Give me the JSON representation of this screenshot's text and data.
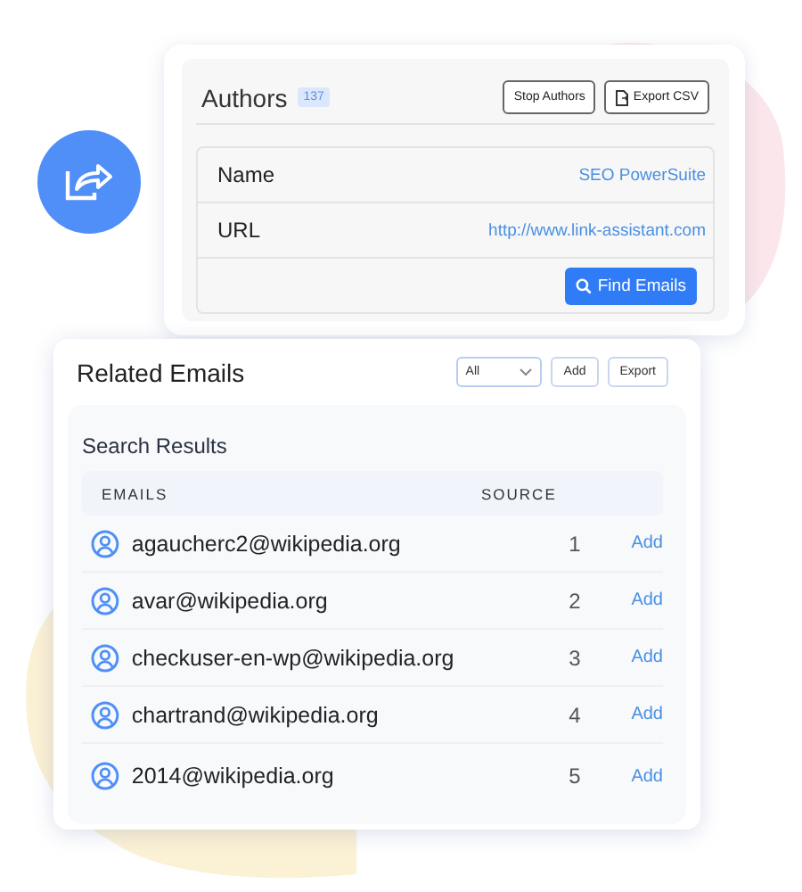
{
  "authors": {
    "title": "Authors",
    "count": "137",
    "buttons": [
      {
        "label": "Stop Authors",
        "kind": "plain"
      },
      {
        "label": "Export CSV",
        "kind": "export"
      }
    ],
    "fields": [
      {
        "label": "Name",
        "value": "SEO PowerSuite"
      },
      {
        "label": "URL",
        "value": "http://www.link-assistant.com"
      }
    ],
    "action": "Find Emails"
  },
  "related_emails": {
    "title": "Related Emails",
    "filter": "All",
    "buttons": [
      "Add",
      "Export"
    ],
    "results": {
      "title": "Search Results",
      "columns": [
        "EMAILS",
        "SOURCE"
      ],
      "rows": [
        {
          "email": "agaucherc2@wikipedia.org",
          "source": "1",
          "action": "Add"
        },
        {
          "email": "avar@wikipedia.org",
          "source": "2",
          "action": "Add"
        },
        {
          "email": "checkuser-en-wp@wikipedia.org",
          "source": "3",
          "action": "Add"
        },
        {
          "email": "chartrand@wikipedia.org",
          "source": "4",
          "action": "Add"
        },
        {
          "email": "2014@wikipedia.org",
          "source": "5",
          "action": "Add"
        }
      ]
    }
  }
}
